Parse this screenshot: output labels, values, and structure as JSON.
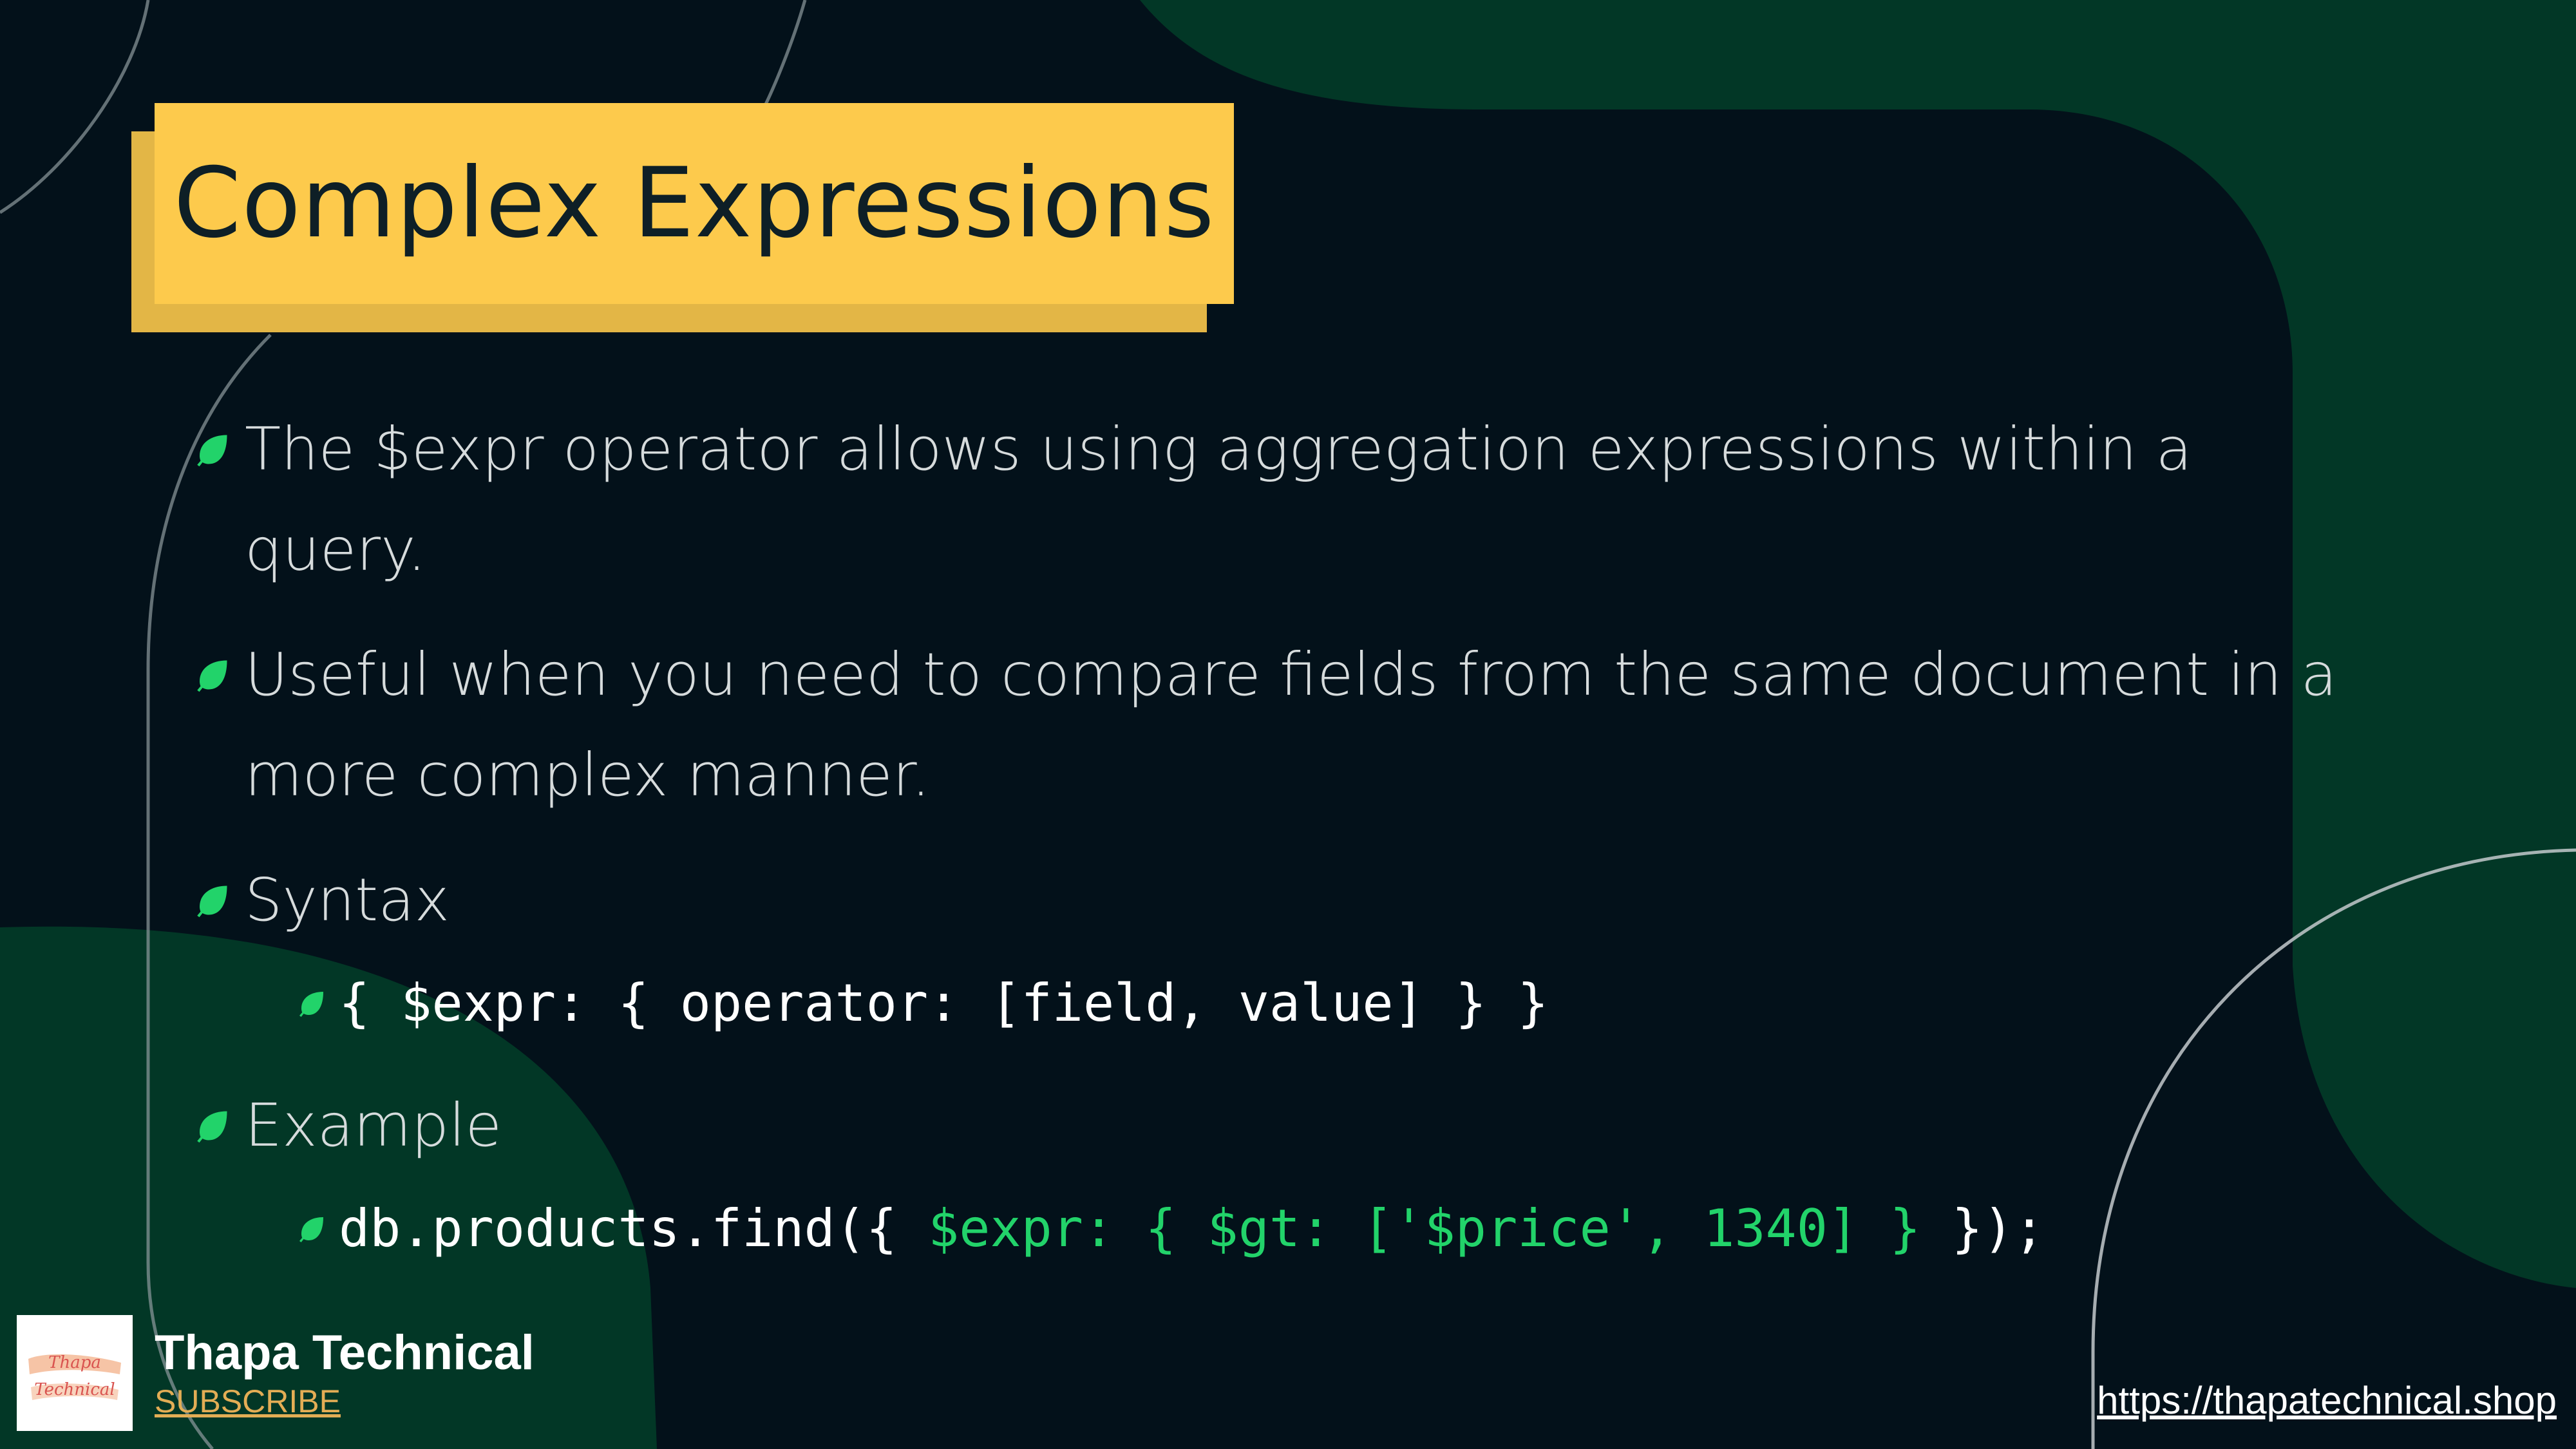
{
  "title": "Complex Expressions",
  "bullets": {
    "b1": "The $expr operator allows using aggregation expressions within a query.",
    "b2": "Useful when you need to compare fields from the same document in a more complex manner.",
    "b3": "Syntax",
    "b4": "Example"
  },
  "syntax_code": "{ $expr: { operator: [field, value] } }",
  "example_code": {
    "prefix": "db.products.find({ ",
    "highlight": "$expr: { $gt: ['$price', 1340] }",
    "suffix": " });"
  },
  "brand": {
    "name": "Thapa Technical",
    "subscribe": "SUBSCRIBE",
    "logo_text": "Thapa Technical"
  },
  "website": "https://thapatechnical.shop",
  "colors": {
    "background": "#03111a",
    "green_shape": "#023726",
    "title_box": "#fdca4c",
    "title_shadow": "#e3b646",
    "leaf": "#22d36a",
    "code_highlight": "#22d36a",
    "subscribe": "#e3ad55"
  },
  "icons": {
    "bullet": "leaf-icon",
    "logo": "brand-logo"
  }
}
